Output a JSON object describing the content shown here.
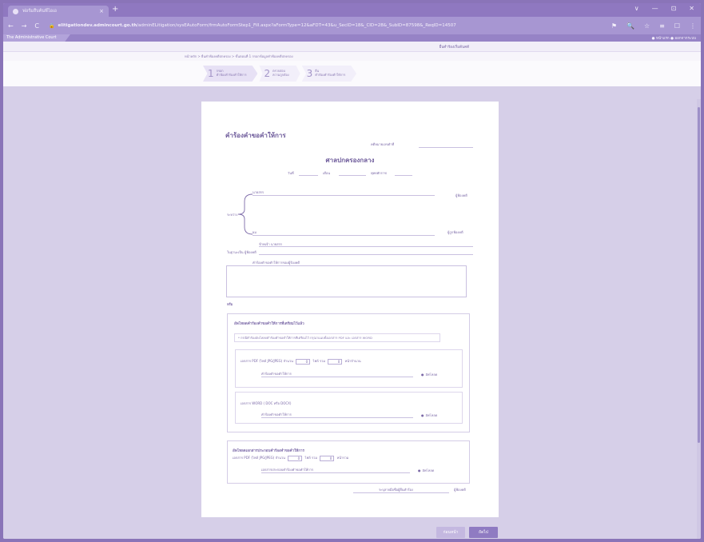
{
  "browser": {
    "tab_title": "ฟอร์มสืบค้นพีไอเอ",
    "tab_close": "×",
    "new_tab": "+",
    "window_controls": [
      "∨",
      "—",
      "⊡",
      "✕"
    ],
    "nav": [
      "←",
      "→",
      "C"
    ],
    "url_host": "elitigationdev.admincourt.go.th",
    "url_path": "/adminELitigation/sysEAutoForm/frmAutoFormStep1_Fill.aspx?aFormType=12&aFDT=43&u_SecID=18&_CID=28&_SubID=87598&_ReqID=14507",
    "right_icons": [
      "⚑",
      "🔍",
      "☆",
      "≡",
      "☐",
      "⋮"
    ]
  },
  "app": {
    "logo": "The Administrative Court",
    "user_links": "● หน้าแรก ● ออกจากระบบ",
    "subnav": "ยื่นคำร้องเริ่มต้นคดี",
    "breadcrumb": "หน้าหลัก > ยื่นคำฟ้องคดีปกครอง > ขั้นตอนที่ 1 กรอกข้อมูลคำฟ้องคดีปกครอง"
  },
  "steps": [
    {
      "num": "1",
      "text": "กรอก\nคำฟ้องคำร้องคำให้การ"
    },
    {
      "num": "2",
      "text": "ตรวจสอบ\nความถูกต้อง"
    },
    {
      "num": "3",
      "text": "ยื่น\nคำฟ้องคำร้องคำให้การ"
    }
  ],
  "form": {
    "title": "คำร้องคำขอคำให้การ",
    "case_no_label": "คดีหมายเลขดำที่",
    "court": "ศาลปกครองกลาง",
    "date_label": "วันที่",
    "month_label": "เดือน",
    "year_label": "พุทธศักราช",
    "plaintiff_name": "นายสรร",
    "plaintiff_role": "ผู้ฟ้องคดี",
    "between_label": "ระหว่าง",
    "defendant_name": "ผม",
    "defendant_role": "ผู้ถูกฟ้องคดี",
    "submitter_label": "ข้าพเจ้า นายสรร",
    "status_label": "ในฐานะเป็น ผู้ฟ้องคดี",
    "request_label": "คำร้องคำขอคำให้การของผู้ร้องคดี",
    "or_label": "หรือ",
    "upload_section": "อัพโหลดคำร้องคำขอคำให้การที่เตรียมไว้แล้ว",
    "notice": "* กรณีคำร้องอัพโหลดคำร้องคำขอคำให้การที่เตรียมไว้ กรุณาแนบทั้งเอกสาร PDF และ เอกสาร WORD",
    "pdf_label": "เอกสาร PDF (ไฟล์ JPG/JPEG) จำนวน",
    "pdf_count": "0",
    "pdf_pages_label": "ไฟล์ รวม",
    "pdf_pages": "0",
    "pages_unit": "หน้าจำนวน",
    "file_label_1": "คำร้องคำขอคำให้การ",
    "upload_1": "อัพโหลด",
    "word_label": "เอกสาร WORD ( DOC หรือ DOCX)",
    "file_label_2": "คำร้องคำขอคำให้การ",
    "upload_2": "อัพโหลด",
    "attach_section": "อัพโหลดเอกสารประกอบคำร้องคำขอคำให้การ",
    "attach_pdf_label": "เอกสาร PDF (ไฟล์ JPG/JPEG) จำนวน",
    "attach_count": "0",
    "attach_pages_label": "ไฟล์ รวม",
    "attach_pages": "0",
    "attach_unit": "หน้ารวม",
    "attach_file_label": "เอกสารประกอบคำร้องคำขอคำให้การ",
    "attach_upload": "อัพโหลด",
    "signature_hint": "ระบุลายมือชื่อผู้ยื่นคำร้อง",
    "signature_role": "ผู้ฟ้องคดี"
  },
  "buttons": {
    "prev": "ก่อนหน้า",
    "next": "ถัดไป"
  }
}
